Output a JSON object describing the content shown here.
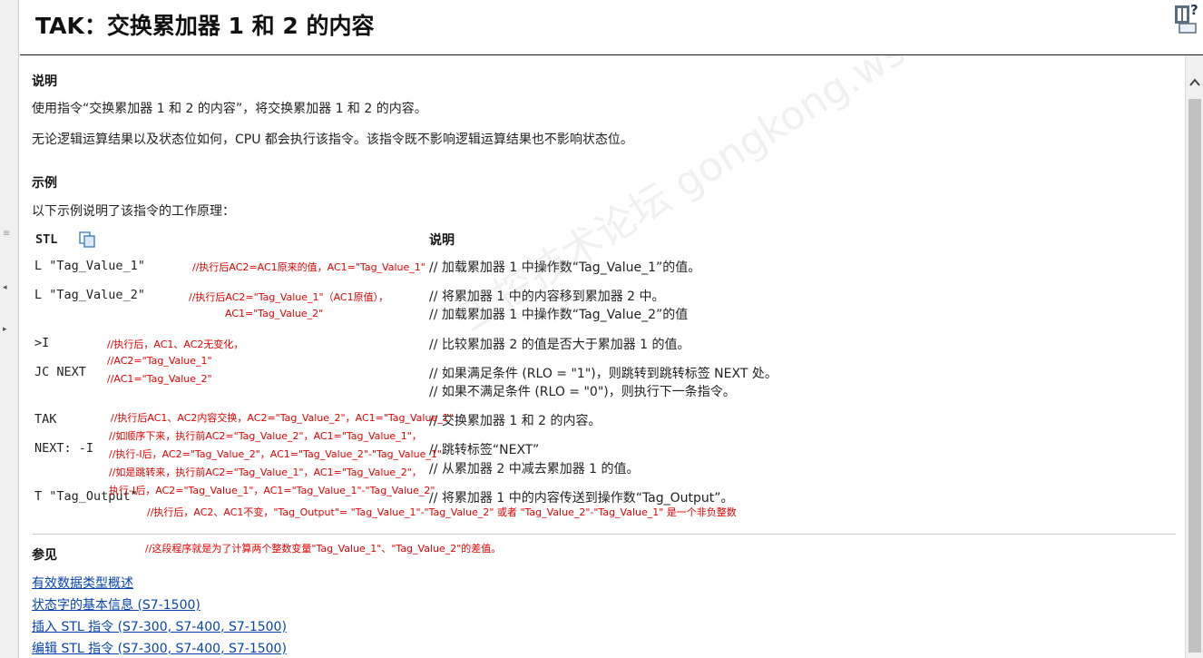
{
  "header": {
    "title": "TAK：交换累加器 1 和 2 的内容"
  },
  "description": {
    "heading": "说明",
    "line1": "使用指令“交换累加器 1 和 2 的内容”，将交换累加器 1 和 2 的内容。",
    "line2": "无论逻辑运算结果以及状态位如何，CPU 都会执行该指令。该指令既不影响逻辑运算结果也不影响状态位。"
  },
  "example": {
    "heading": "示例",
    "intro": "以下示例说明了该指令的工作原理：",
    "col_stl": "STL",
    "col_desc": "说明",
    "rows": [
      {
        "code": "L \"Tag_Value_1\"",
        "desc1": "// 加载累加器 1 中操作数“Tag_Value_1”的值。",
        "desc2": ""
      },
      {
        "code": "L \"Tag_Value_2\"",
        "desc1": "// 将累加器 1 中的内容移到累加器 2 中。",
        "desc2": "// 加载累加器 1 中操作数“Tag_Value_2”的值"
      },
      {
        "code": ">I",
        "desc1": "// 比较累加器 2 的值是否大于累加器 1 的值。",
        "desc2": ""
      },
      {
        "code": "JC NEXT",
        "desc1": "// 如果满足条件 (RLO = \"1\")，则跳转到跳转标签 NEXT 处。",
        "desc2": "// 如果不满足条件 (RLO = \"0\")，则执行下一条指令。"
      },
      {
        "code": "TAK",
        "desc1": "// 交换累加器 1 和 2 的内容。",
        "desc2": ""
      },
      {
        "code": "NEXT: -I",
        "desc1": "// 跳转标签“NEXT”",
        "desc2": "// 从累加器 2 中减去累加器 1 的值。"
      },
      {
        "code": "T \"Tag_Output\"",
        "desc1": "// 将累加器 1 中的内容传送到操作数“Tag_Output”。",
        "desc2": ""
      }
    ]
  },
  "annotations": {
    "a1": "//执行后AC2=AC1原来的值，AC1=\"Tag_Value_1\"",
    "a2a": "//执行后AC2=\"Tag_Value_1\"（AC1原值），",
    "a2b": "AC1=\"Tag_Value_2\"",
    "a3a": "//执行后，AC1、AC2无变化，",
    "a3b": "//AC2=\"Tag_Value_1\"",
    "a3c": "//AC1=\"Tag_Value_2\"",
    "a4": "//执行后AC1、AC2内容交换，AC2=\"Tag_Value_2\"，AC1=\"Tag_Value_1\"",
    "a5a": "//如顺序下来，执行前AC2=\"Tag_Value_2\"，AC1=\"Tag_Value_1\"，",
    "a5b": "//执行-I后，AC2=\"Tag_Value_2\"，AC1=\"Tag_Value_2\"-\"Tag_Value_1\"",
    "a5c": "//如是跳转来，执行前AC2=\"Tag_Value_1\"，AC1=\"Tag_Value_2\"，",
    "a5d": "执行-I后，AC2=\"Tag_Value_1\"，AC1=\"Tag_Value_1\"-\"Tag_Value_2\"",
    "a6": "//执行后，AC2、AC1不变，\"Tag_Output\"= \"Tag_Value_1\"-\"Tag_Value_2\" 或者 \"Tag_Value_2\"-\"Tag_Value_1\" 是一个非负整数",
    "a7": "//这段程序就是为了计算两个整数变量\"Tag_Value_1\"、\"Tag_Value_2\"的差值。"
  },
  "see_also": {
    "heading": "参见",
    "links": [
      "有效数据类型概述",
      "状态字的基本信息 (S7-1500)",
      "插入 STL 指令 (S7-300, S7-400, S7-1500)",
      "编辑 STL 指令 (S7-300, S7-400, S7-1500)"
    ]
  },
  "watermark": "工控技术论坛 gongkong.ws",
  "icons": {
    "help": "help-icon",
    "copy": "copy-icon",
    "scroll_up": "chevron-up-icon"
  }
}
